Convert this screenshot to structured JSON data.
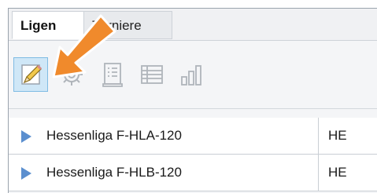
{
  "tabs": [
    {
      "label": "Ligen",
      "active": true
    },
    {
      "label": "Turniere",
      "active": false
    }
  ],
  "toolbar": {
    "items": [
      {
        "icon": "pencil-edit-icon",
        "selected": true
      },
      {
        "icon": "gear-icon",
        "selected": false
      },
      {
        "icon": "checklist-document-icon",
        "selected": false
      },
      {
        "icon": "table-list-icon",
        "selected": false
      },
      {
        "icon": "bar-chart-icon",
        "selected": false
      }
    ]
  },
  "table": {
    "rows": [
      {
        "name": "Hessenliga F-HLA-120",
        "code": "HE"
      },
      {
        "name": "Hessenliga F-HLB-120",
        "code": "HE"
      }
    ]
  },
  "colors": {
    "accent_arrow": "#f08a2c",
    "selection_bg": "#cfe7f7",
    "expander": "#5b8fcf"
  }
}
